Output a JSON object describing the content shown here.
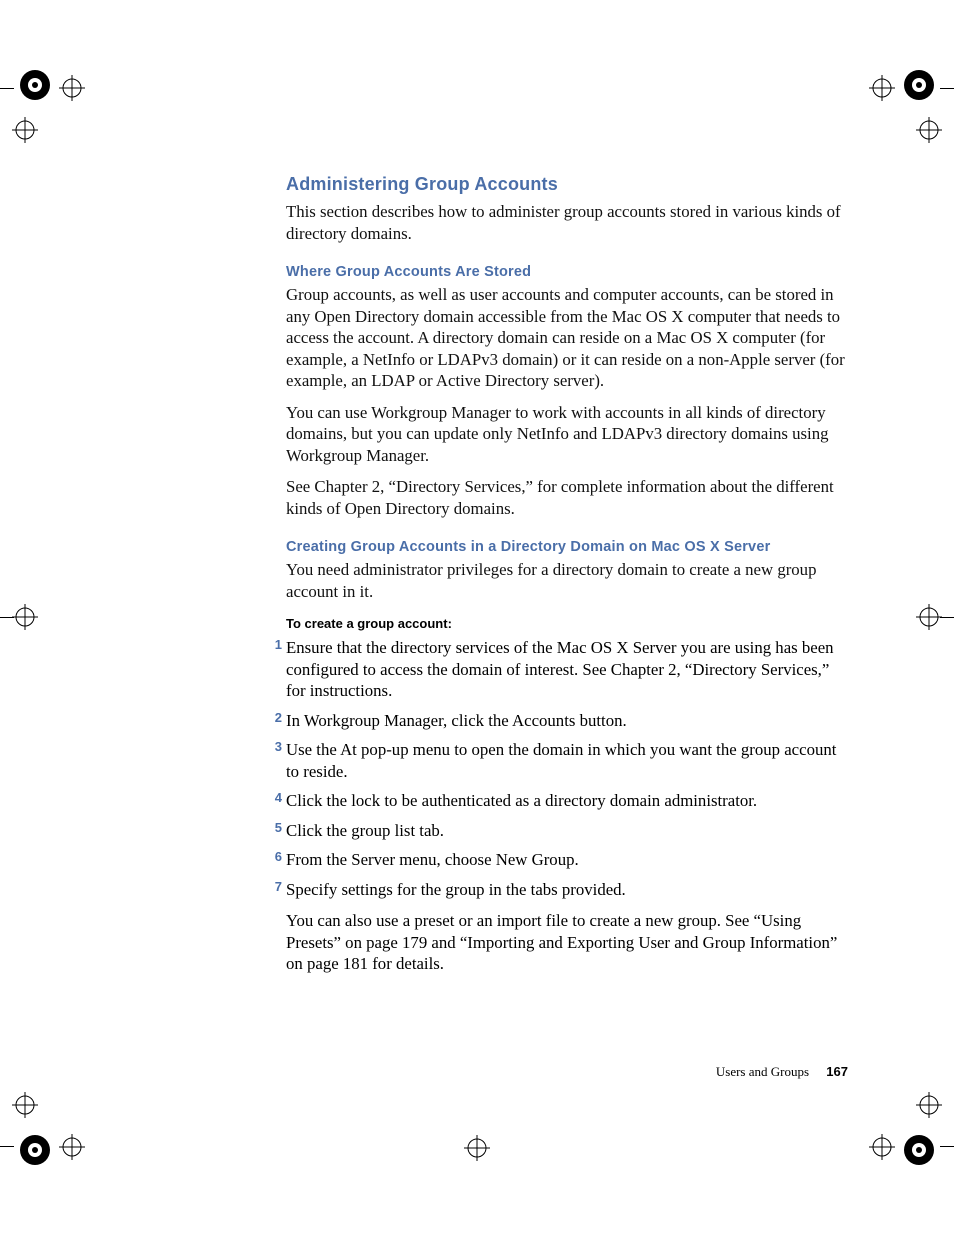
{
  "section": {
    "title": "Administering Group Accounts",
    "intro": "This section describes how to administer group accounts stored in various kinds of directory domains."
  },
  "sub1": {
    "title": "Where Group Accounts Are Stored",
    "p1": "Group accounts, as well as user accounts and computer accounts, can be stored in any Open Directory domain accessible from the Mac OS X computer that needs to access the account. A directory domain can reside on a Mac OS X computer (for example, a NetInfo or LDAPv3 domain) or it can reside on a non-Apple server (for example, an LDAP or Active Directory server).",
    "p2": "You can use Workgroup Manager to work with accounts in all kinds of directory domains, but you can update only NetInfo and LDAPv3 directory domains using Workgroup Manager.",
    "p3": "See Chapter 2, “Directory Services,” for complete information about the different kinds of Open Directory domains."
  },
  "sub2": {
    "title": "Creating Group Accounts in a Directory Domain on Mac OS X Server",
    "p1": "You need administrator privileges for a directory domain to create a new group account in it.",
    "procTitle": "To create a group account:",
    "steps": [
      "Ensure that the directory services of the Mac OS X Server you are using has been configured to access the domain of interest. See Chapter 2, “Directory Services,” for instructions.",
      "In Workgroup Manager, click the Accounts button.",
      "Use the At pop-up menu to open the domain in which you want the group account to reside.",
      "Click the lock to be authenticated as a directory domain administrator.",
      "Click the group list tab.",
      "From the Server menu, choose New Group.",
      "Specify settings for the group in the tabs provided."
    ],
    "followup": "You can also use a preset or an import file to create a new group. See “Using Presets” on page 179 and “Importing and Exporting User and Group Information” on page 181 for details."
  },
  "footer": {
    "chapter": "Users and Groups",
    "page": "167"
  }
}
